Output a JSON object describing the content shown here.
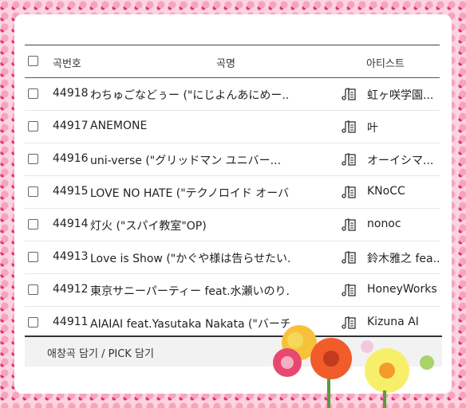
{
  "header": {
    "select_all": "",
    "col_num": "곡번호",
    "col_title": "곡명",
    "col_artist": "아티스트"
  },
  "rows": [
    {
      "num": "44918",
      "title": "わちゅごなどぅー (\"にじよんあにめー..",
      "artist": "虹ヶ咲学園..."
    },
    {
      "num": "44917",
      "title": "ANEMONE",
      "artist": "叶"
    },
    {
      "num": "44916",
      "title": "uni-verse (\"グリッドマン ユニバー...",
      "artist": "オーイシマ..."
    },
    {
      "num": "44915",
      "title": "LOVE NO HATE (\"テクノロイド オーバ..",
      "artist": "KNoCC"
    },
    {
      "num": "44914",
      "title": "灯火 (\"スパイ教室\"OP)",
      "artist": "nonoc"
    },
    {
      "num": "44913",
      "title": "Love is Show (\"かぐや様は告らせたい..",
      "artist": "鈴木雅之 fea..."
    },
    {
      "num": "44912",
      "title": "東京サニーパーティー feat.水瀬いのり..",
      "artist": "HoneyWorks"
    },
    {
      "num": "44911",
      "title": "AIAIAI feat.Yasutaka Nakata (\"バーチャ..",
      "artist": "Kizuna AI"
    }
  ],
  "footer": {
    "label": "애창곡 담기 / PICK 담기"
  },
  "icons": {
    "lyrics": "music-lyrics-icon"
  }
}
